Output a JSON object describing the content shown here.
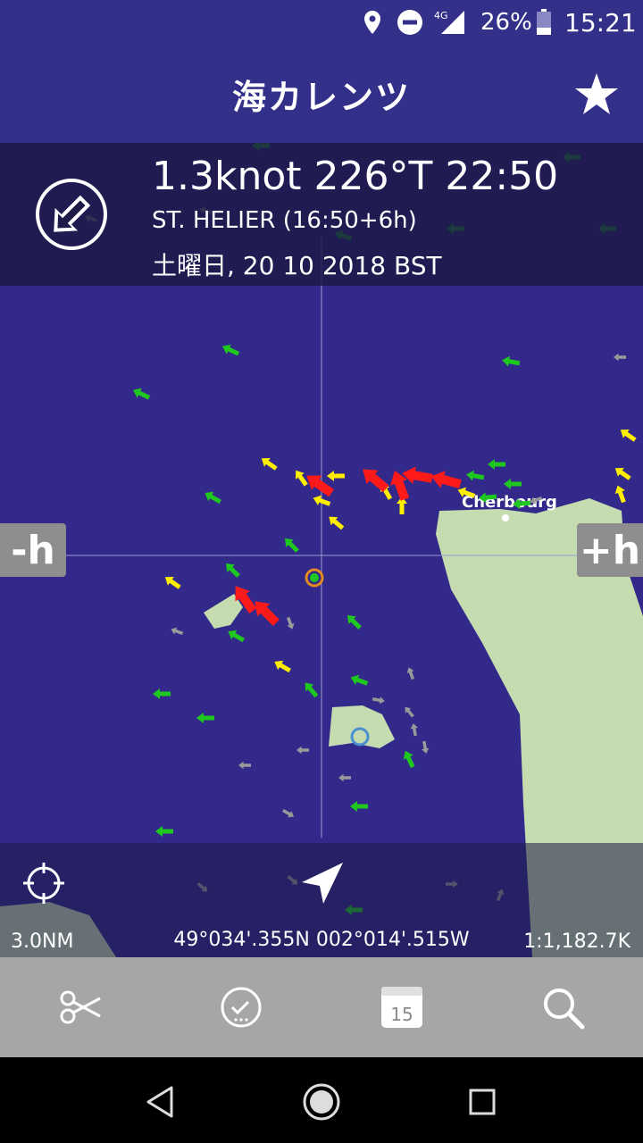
{
  "status_bar": {
    "network": "4G",
    "battery": "26%",
    "time": "15:21"
  },
  "header": {
    "title": "海カレンツ",
    "favorite_icon": "star-icon"
  },
  "info": {
    "speed_text": "1.3knot 226°T 22:50",
    "station_text": "ST. HELIER (16:50+6h)",
    "date_text": "土曜日, 20 10 2018 BST",
    "direction_icon": "arrow-down-left-icon"
  },
  "map": {
    "place_label": "Cherbourg",
    "minus_hour": "-h",
    "plus_hour": "+h",
    "scale": "3.0NM",
    "coordinates": "49°034'.355N 002°014'.515W",
    "ratio": "1:1,182.7K",
    "colors": {
      "sea": "#33298a",
      "land": "#c4dcb0",
      "strong": "#ff1a1a",
      "medium": "#ffee00",
      "weak": "#1ec81e",
      "slack": "#9a9a9a"
    }
  },
  "toolbar": {
    "items": [
      "scissors-icon",
      "clock-icon",
      "calendar-icon",
      "search-icon"
    ],
    "calendar_day": "15"
  },
  "android_nav": [
    "back-icon",
    "home-icon",
    "recents-icon"
  ]
}
